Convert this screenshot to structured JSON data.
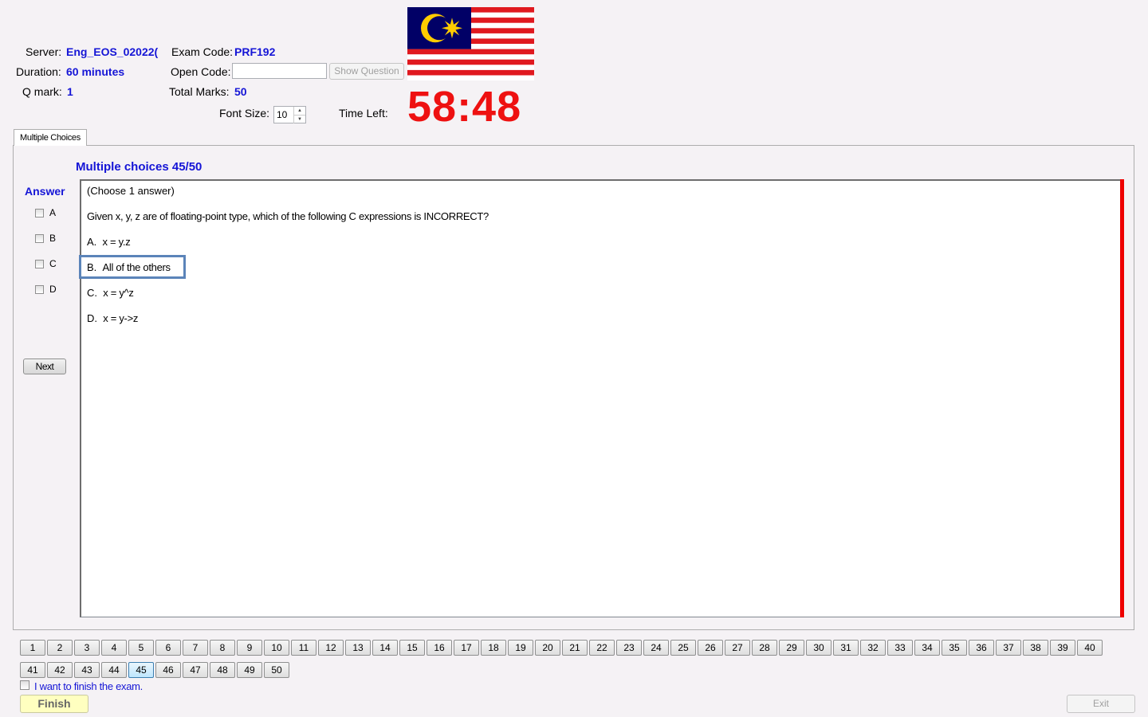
{
  "header": {
    "server_label": "Server:",
    "server_value": "Eng_EOS_02022(",
    "exam_code_label": "Exam Code:",
    "exam_code_value": "PRF192",
    "duration_label": "Duration:",
    "duration_value": "60 minutes",
    "open_code_label": "Open Code:",
    "open_code_value": "",
    "show_question_label": "Show Question",
    "qmark_label": "Q mark:",
    "qmark_value": "1",
    "total_marks_label": "Total Marks:",
    "total_marks_value": "50",
    "font_size_label": "Font Size:",
    "font_size_value": "10",
    "time_left_label": "Time Left:",
    "time_left_value": "58:48"
  },
  "tab": {
    "label": "Multiple Choices"
  },
  "question": {
    "progress": "Multiple choices 45/50",
    "instruction": "(Choose 1 answer)",
    "text": "Given x, y, z are of floating-point type, which of the following C expressions is INCORRECT?",
    "options": [
      {
        "letter": "A.",
        "text": "x = y.z"
      },
      {
        "letter": "B.",
        "text": "All of the others"
      },
      {
        "letter": "C.",
        "text": "x = y^z"
      },
      {
        "letter": "D.",
        "text": "x = y->z"
      }
    ]
  },
  "answer": {
    "title": "Answer",
    "choices": [
      "A",
      "B",
      "C",
      "D"
    ],
    "next_label": "Next"
  },
  "navigation": {
    "row1": [
      "1",
      "2",
      "3",
      "4",
      "5",
      "6",
      "7",
      "8",
      "9",
      "10",
      "11",
      "12",
      "13",
      "14",
      "15",
      "16",
      "17",
      "18",
      "19",
      "20",
      "21",
      "22",
      "23",
      "24",
      "25",
      "26",
      "27",
      "28",
      "29",
      "30",
      "31",
      "32",
      "33",
      "34",
      "35",
      "36",
      "37",
      "38",
      "39",
      "40"
    ],
    "row2": [
      "41",
      "42",
      "43",
      "44",
      "45",
      "46",
      "47",
      "48",
      "49",
      "50"
    ],
    "current": "45"
  },
  "footer": {
    "finish_checkbox_label": "I want to finish the exam.",
    "finish_label": "Finish",
    "exit_label": "Exit"
  },
  "colors": {
    "value_blue": "#1515d6",
    "timer_red": "#ee1111",
    "finish_yellow": "#ffffc0"
  }
}
